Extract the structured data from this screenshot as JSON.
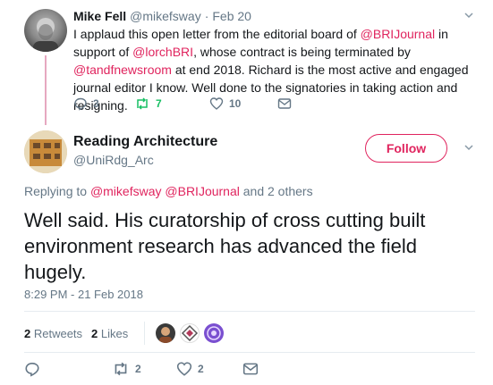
{
  "tweet1": {
    "name": "Mike Fell",
    "handle": "@mikefsway",
    "sep": "·",
    "date": "Feb 20",
    "text_parts": [
      {
        "t": "I applaud this open letter from the editorial board of ",
        "k": "plain"
      },
      {
        "t": "@BRIJournal",
        "k": "link"
      },
      {
        "t": " in support of ",
        "k": "plain"
      },
      {
        "t": "@lorchBRI",
        "k": "link"
      },
      {
        "t": ", whose contract is being terminated by ",
        "k": "plain"
      },
      {
        "t": "@tandfnewsroom",
        "k": "link"
      },
      {
        "t": " at end 2018. Richard is the most active and engaged journal editor I know. Well done to the signatories in taking action and resigning.",
        "k": "plain"
      }
    ],
    "actions": {
      "replies": "3",
      "retweets": "7",
      "likes": "10"
    }
  },
  "tweet2": {
    "name": "Reading Architecture",
    "handle": "@UniRdg_Arc",
    "follow_label": "Follow",
    "replying_prefix": "Replying to ",
    "replying_to_1": "@mikefsway",
    "replying_to_2": "@BRIJournal",
    "replying_suffix": " and 2 others",
    "text": "Well said. His curatorship of cross cutting built environment research has advanced the field hugely.",
    "timestamp": "8:29 PM - 21 Feb 2018",
    "stats": {
      "retweets_num": "2",
      "retweets_label": " Retweets",
      "likes_num": "2",
      "likes_label": " Likes"
    },
    "actions": {
      "retweets": "2",
      "likes": "2"
    }
  },
  "icons": {
    "reply": "reply-icon",
    "retweet": "retweet-icon",
    "like": "heart-icon",
    "dm": "envelope-icon",
    "more": "chevron-down-icon"
  },
  "colors": {
    "accent": "#e0245e",
    "retweet": "#17bf63",
    "muted": "#657786"
  }
}
